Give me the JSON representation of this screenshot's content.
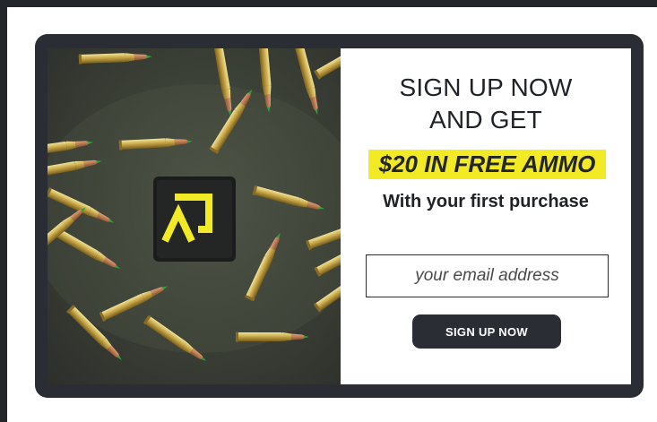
{
  "popup": {
    "headline_line1": "SIGN UP NOW",
    "headline_line2": "AND GET",
    "offer": "$20 IN FREE AMMO",
    "subline": "With your first purchase",
    "email_placeholder": "your email address",
    "cta_label": "SIGN UP NOW"
  },
  "colors": {
    "accent_yellow": "#f3ea26",
    "dark": "#2a2d33"
  },
  "image": {
    "subject": "rifle cartridges on concrete with yellow logo patch",
    "logo_icon": "brand-logo-icon"
  }
}
